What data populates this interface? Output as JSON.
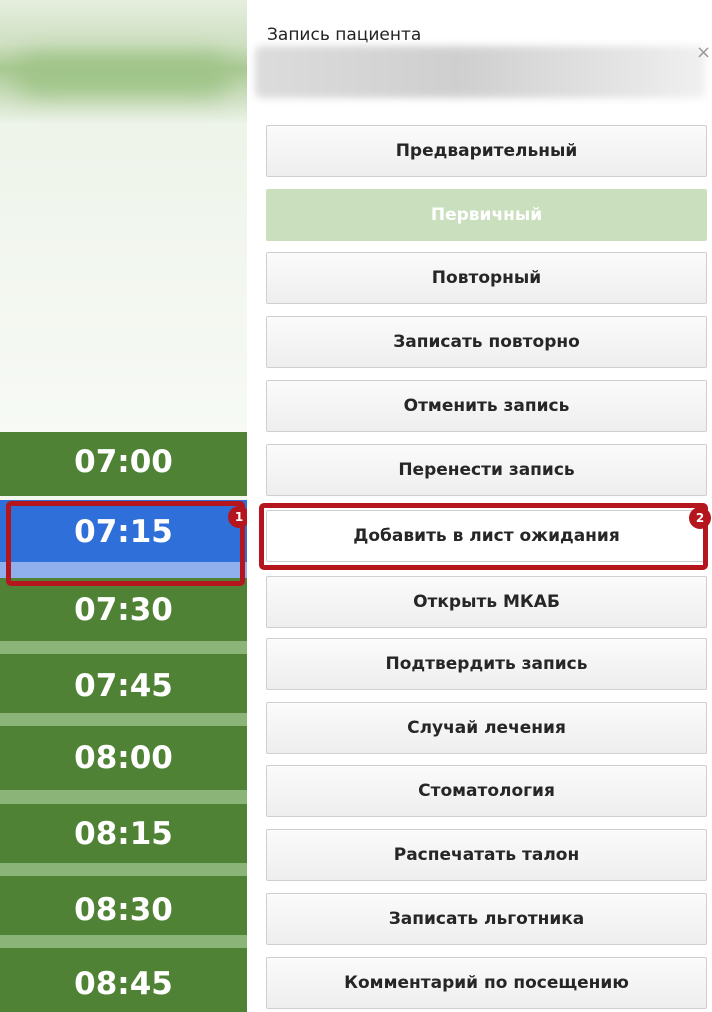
{
  "dialog": {
    "title": "Запись пациента",
    "close_glyph": "×"
  },
  "schedule": {
    "slots": [
      {
        "time": "07:00",
        "state": "available"
      },
      {
        "time": "07:15",
        "state": "selected"
      },
      {
        "time": "07:30",
        "state": "available"
      },
      {
        "time": "07:45",
        "state": "available"
      },
      {
        "time": "08:00",
        "state": "available"
      },
      {
        "time": "08:15",
        "state": "available"
      },
      {
        "time": "08:30",
        "state": "available"
      },
      {
        "time": "08:45",
        "state": "available"
      }
    ]
  },
  "menu": {
    "items": [
      {
        "label": "Предварительный",
        "state": "normal"
      },
      {
        "label": "Первичный",
        "state": "disabled"
      },
      {
        "label": "Повторный",
        "state": "normal"
      },
      {
        "label": "Записать повторно",
        "state": "normal"
      },
      {
        "label": "Отменить запись",
        "state": "normal"
      },
      {
        "label": "Перенести запись",
        "state": "normal"
      },
      {
        "label": "Добавить в лист ожидания",
        "state": "highlighted"
      },
      {
        "label": "Открыть МКАБ",
        "state": "normal"
      },
      {
        "label": "Подтвердить запись",
        "state": "normal"
      },
      {
        "label": "Случай лечения",
        "state": "normal"
      },
      {
        "label": "Стоматология",
        "state": "normal"
      },
      {
        "label": "Распечатать талон",
        "state": "normal"
      },
      {
        "label": "Записать льготника",
        "state": "normal"
      },
      {
        "label": "Комментарий по посещению",
        "state": "normal"
      }
    ]
  },
  "annotations": {
    "badge_1": "1",
    "badge_2": "2"
  },
  "colors": {
    "slot_available": "#4f8234",
    "slot_selected": "#2f6fd9",
    "highlight": "#b5151d",
    "disabled_button": "#c9dfbd"
  }
}
